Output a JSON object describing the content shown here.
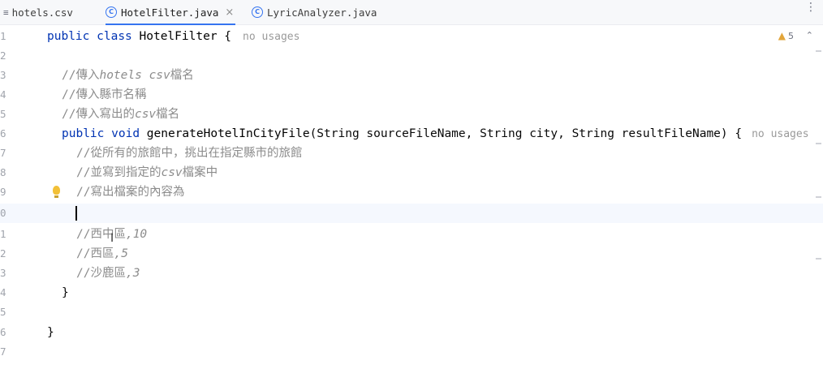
{
  "tabs": [
    {
      "label": "hotels.csv",
      "icon": "csv-file-icon"
    },
    {
      "label": "HotelFilter.java",
      "icon": "java-class-icon",
      "close": "×"
    },
    {
      "label": "LyricAnalyzer.java",
      "icon": "java-class-icon"
    }
  ],
  "tab_class_glyph": "C",
  "more_glyph": "⋮",
  "inspection": {
    "count": "5",
    "warning_glyph": "▲",
    "collapse_glyph": "⌃"
  },
  "hint": "no usages",
  "line_numbers": [
    "1",
    "2",
    "3",
    "4",
    "5",
    "6",
    "7",
    "8",
    "9",
    "0",
    "1",
    "2",
    "3",
    "4",
    "5",
    "6",
    "7"
  ],
  "code": {
    "l1_kw1": "public",
    "l1_kw2": "class",
    "l1_name": "HotelFilter",
    "l1_brace": " {",
    "l3_pre": "//傳入",
    "l3_it": "hotels csv",
    "l3_post": "檔名",
    "l4": "//傳入縣市名稱",
    "l5_pre": "//傳入寫出的",
    "l5_it": "csv",
    "l5_post": "檔名",
    "l6_kw1": "public",
    "l6_kw2": "void",
    "l6_name": "generateHotelInCityFile",
    "l6_sig": "(String sourceFileName, String city, String resultFileName) {",
    "l7": "//從所有的旅館中，挑出在指定縣市的旅館",
    "l8_pre": "//並寫到指定的",
    "l8_it": "csv",
    "l8_post": "檔案中",
    "l9": "//寫出檔案的內容為",
    "l11_pre": "//西中區",
    "l11_it": ",10",
    "l12_pre": "//西區",
    "l12_it": ",5",
    "l13_pre": "//沙鹿區",
    "l13_it": ",3",
    "l14": "}",
    "l16": "}"
  },
  "ibeam_glyph": "I"
}
